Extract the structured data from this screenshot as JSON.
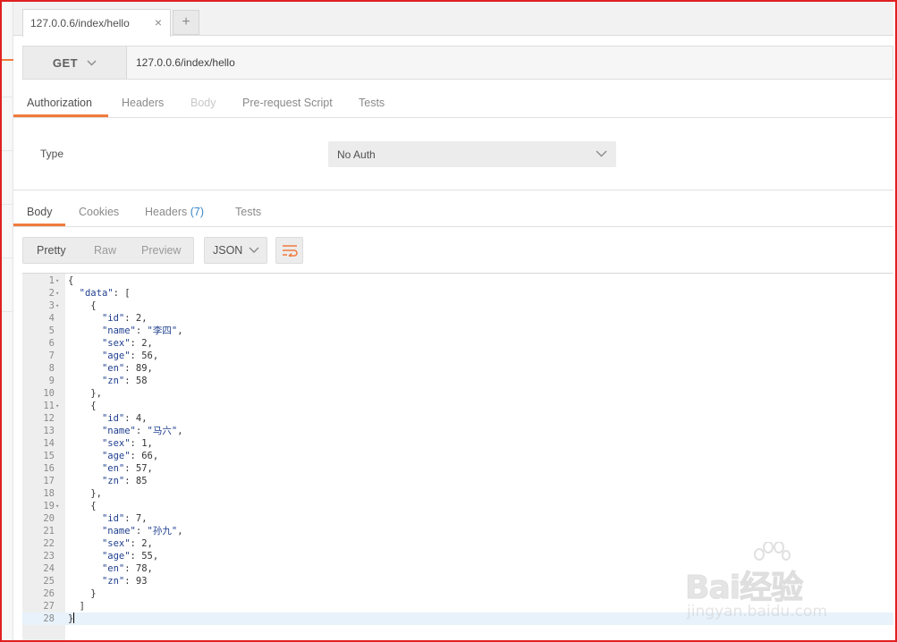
{
  "tab": {
    "title": "127.0.0.6/index/hello",
    "close_glyph": "×",
    "new_tab_glyph": "+"
  },
  "request": {
    "method": "GET",
    "url": "127.0.0.6/index/hello",
    "tabs": [
      "Authorization",
      "Headers",
      "Body",
      "Pre-request Script",
      "Tests"
    ],
    "active_tab": "Authorization",
    "auth": {
      "type_label": "Type",
      "type_value": "No Auth"
    }
  },
  "response": {
    "tabs": {
      "body": "Body",
      "cookies": "Cookies",
      "headers": "Headers",
      "headers_count": "(7)",
      "tests": "Tests"
    },
    "view_modes": [
      "Pretty",
      "Raw",
      "Preview"
    ],
    "active_view": "Pretty",
    "format": "JSON",
    "body_lines": [
      "{",
      "  \"data\": [",
      "    {",
      "      \"id\": 2,",
      "      \"name\": \"李四\",",
      "      \"sex\": 2,",
      "      \"age\": 56,",
      "      \"en\": 89,",
      "      \"zn\": 58",
      "    },",
      "    {",
      "      \"id\": 4,",
      "      \"name\": \"马六\",",
      "      \"sex\": 1,",
      "      \"age\": 66,",
      "      \"en\": 57,",
      "      \"zn\": 85",
      "    },",
      "    {",
      "      \"id\": 7,",
      "      \"name\": \"孙九\",",
      "      \"sex\": 2,",
      "      \"age\": 55,",
      "      \"en\": 78,",
      "      \"zn\": 93",
      "    }",
      "  ]",
      "}"
    ],
    "foldable_lines": [
      1,
      2,
      3,
      11,
      19
    ],
    "current_line": 28
  },
  "watermark": {
    "main": "Bai经验",
    "sub": "jingyan.baidu.com"
  },
  "colors": {
    "accent": "#f07a3c",
    "frame": "#e02020",
    "count": "#3a86c8"
  },
  "icons": [
    "close-icon",
    "plus-icon",
    "chevron-down-icon",
    "wrap-lines-icon"
  ]
}
